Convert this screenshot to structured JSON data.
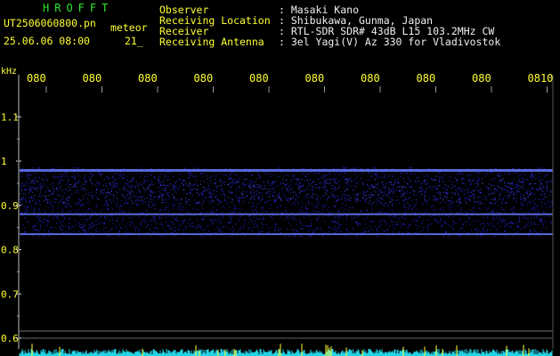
{
  "header": {
    "brand": "HROFFT",
    "filename": "UT2506060800.pn",
    "mode": "meteor",
    "datetime": "25.06.06 08:00",
    "counter": "21_",
    "info": [
      {
        "label": "Observer",
        "value": ": Masaki Kano"
      },
      {
        "label": "Receiving Location",
        "value": ": Shibukawa, Gunma, Japan"
      },
      {
        "label": "Receiver",
        "value": ": RTL-SDR SDR# 43dB L15 103.2MHz CW"
      },
      {
        "label": "Receiving Antenna",
        "value": ": 3el Yagi(V) Az 330 for Vladivostok"
      }
    ]
  },
  "spectrogram": {
    "freq_unit": "kHz",
    "time_labels": [
      "080",
      "080",
      "080",
      "080",
      "080",
      "080",
      "080",
      "080",
      "080",
      "0810"
    ],
    "freq_labels": [
      "1.1",
      "1",
      "0.9",
      "0.8",
      "0.7",
      "0.6"
    ],
    "freq_range_khz": [
      0.58,
      1.15
    ],
    "noise_band_khz": [
      0.83,
      0.985
    ],
    "carrier_lines_khz": [
      0.98,
      0.88,
      0.835
    ],
    "colors": {
      "background": "#000000",
      "noise": "#2a2cff",
      "carrier": "#6a7cff",
      "labels": "#ffff33",
      "bottom_noise": "#22d3e6",
      "bottom_spikes": "#ffff33"
    }
  }
}
